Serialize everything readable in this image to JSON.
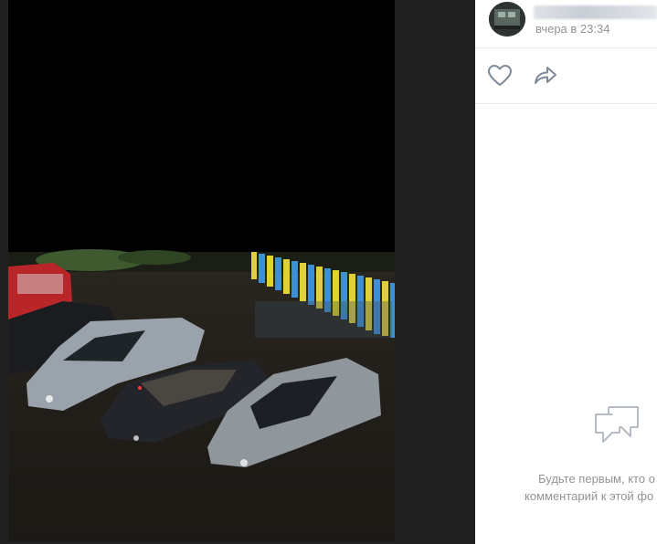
{
  "post": {
    "author_name": "",
    "time": "вчера в 23:34"
  },
  "actions": {
    "like_icon": "heart-outline-icon",
    "share_icon": "share-arrow-icon"
  },
  "comments": {
    "empty_icon": "comment-bubbles-icon",
    "empty_line1": "Будьте первым, кто о",
    "empty_line2": "комментарий к этой фо"
  }
}
